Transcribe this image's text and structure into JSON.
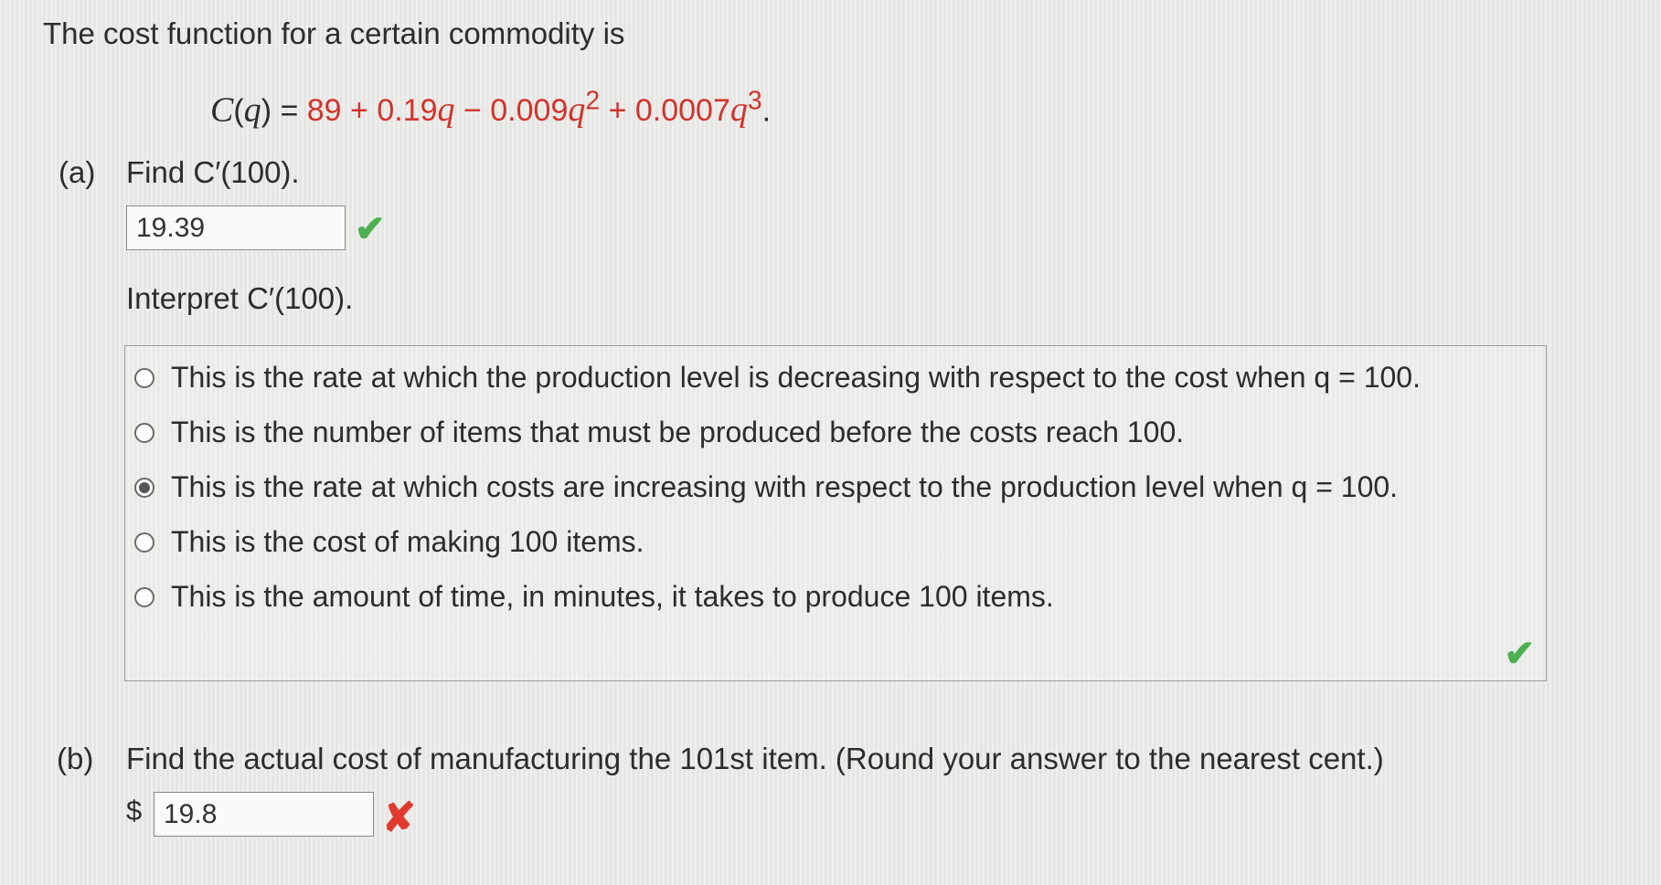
{
  "intro": "The cost function for a certain commodity is",
  "formula": {
    "lhs": "C(q) = ",
    "t1": "89 + 0.19",
    "t2": " − 0.009",
    "t3": " + 0.0007",
    "exp2": "2",
    "exp3": "3",
    "end": "."
  },
  "part_a": {
    "label": "(a)",
    "question": "Find C′(100).",
    "answer_value": "19.39",
    "answer_status": "correct",
    "interpret_prompt": "Interpret C′(100).",
    "options": [
      "This is the rate at which the production level is decreasing with respect to the cost when q = 100.",
      "This is the number of items that must be produced before the costs reach 100.",
      "This is the rate at which costs are increasing with respect to the production level when q = 100.",
      "This is the cost of making 100 items.",
      "This is the amount of time, in minutes, it takes to produce 100 items."
    ],
    "selected_option_index": 2,
    "interpret_status": "correct"
  },
  "part_b": {
    "label": "(b)",
    "question": "Find the actual cost of manufacturing the 101st item. (Round your answer to the nearest cent.)",
    "currency": "$",
    "answer_value": "19.8",
    "answer_status": "incorrect"
  },
  "colors": {
    "red_term": "#d0342c",
    "check": "#4caf50",
    "cross": "#e03a2e"
  },
  "icons": {
    "correct": "check-icon",
    "incorrect": "cross-icon"
  }
}
